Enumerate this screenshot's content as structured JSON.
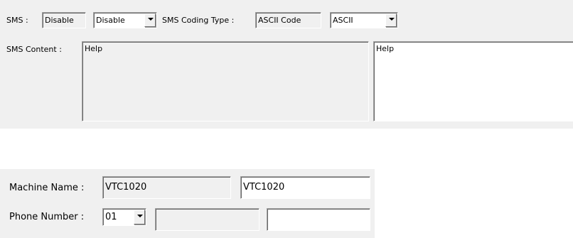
{
  "sms": {
    "label": "SMS :",
    "value": "Disable",
    "dropdown_value": "Disable",
    "coding_type_label": "SMS Coding Type :",
    "coding_type_value": "ASCII Code",
    "coding_dropdown_value": "ASCII",
    "content_label": "SMS Content :",
    "content_value": "Help",
    "content_edit_value": "Help"
  },
  "machine": {
    "name_label": "Machine Name :",
    "name_value": "VTC1020",
    "name_edit_value": "VTC1020",
    "phone_label": "Phone Number :",
    "phone_prefix": "01",
    "phone_value": "",
    "phone_edit_value": ""
  },
  "icons": {
    "dropdown": "chevron-down-icon"
  }
}
